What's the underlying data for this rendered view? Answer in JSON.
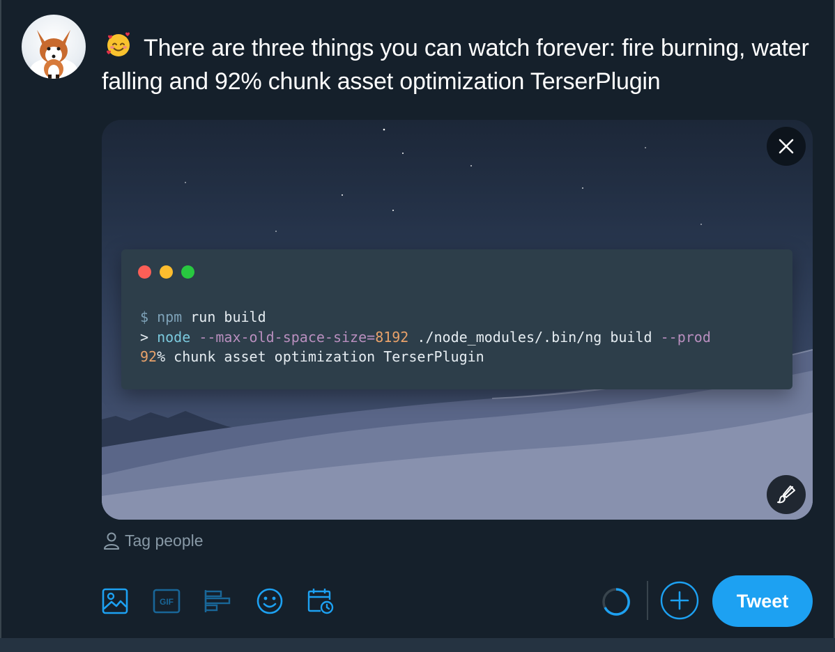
{
  "composer": {
    "emoji_icon": "smiling-face-with-hearts-icon",
    "text": "There are three things you can watch forever: fire burning, water falling and 92% chunk asset optimization TerserPlugin"
  },
  "media": {
    "terminal": {
      "line1": {
        "prompt": "$",
        "cmd": "npm",
        "rest": "run build"
      },
      "line2": {
        "prompt": ">",
        "node": "node",
        "flag": "--max-old-space-size=",
        "num": "8192",
        "path": "./node_modules/.bin/ng build",
        "flag2": "--prod"
      },
      "line3": {
        "num": "92",
        "rest": "% chunk asset optimization TerserPlugin"
      }
    },
    "remove_icon": "close-icon",
    "edit_icon": "paintbrush-icon"
  },
  "tag_people": {
    "icon": "person-icon",
    "label": "Tag people"
  },
  "toolbar": {
    "icons": [
      "image-icon",
      "gif-icon",
      "poll-icon",
      "emoji-icon",
      "schedule-icon"
    ],
    "gif_label": "GIF",
    "add_icon": "plus-circle-icon",
    "tweet_label": "Tweet"
  },
  "colors": {
    "background": "#15202b",
    "accent": "#1da1f2",
    "muted": "#8899a6",
    "terminal_bg": "#2d3e4a"
  }
}
